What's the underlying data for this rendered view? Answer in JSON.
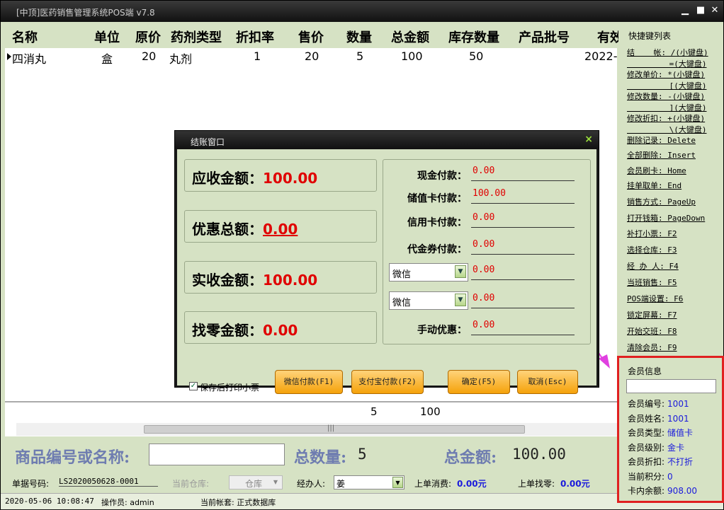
{
  "app": {
    "title": "[中顶]医药销售管理系统POS端 v7.8",
    "min": "▁",
    "max": "■",
    "close": "✕"
  },
  "grid": {
    "headers": [
      "名称",
      "单位",
      "原价",
      "药剂类型",
      "折扣率",
      "售价",
      "数量",
      "总金额",
      "库存数量",
      "产品批号",
      "有效"
    ],
    "row": [
      "四消丸",
      "盒",
      "20",
      "丸剂",
      "1",
      "20",
      "5",
      "100",
      "50",
      "",
      "2022-"
    ],
    "sum_qty": "5",
    "sum_amount": "100",
    "grip": "|||"
  },
  "bottom": {
    "code_label": "商品编号或名称:",
    "code_value": "",
    "total_qty_label": "总数量:",
    "total_qty": "5",
    "total_amount_label": "总金额:",
    "total_amount": "100.00",
    "bill_label": "单据号码:",
    "bill_no": "LS2020050628-0001",
    "warehouse_label": "当前仓库:",
    "warehouse": "仓库",
    "handler_label": "经办人:",
    "handler": "姜",
    "last_spend_label": "上单消费:",
    "last_spend": "0.00元",
    "last_change_label": "上单找零:",
    "last_change": "0.00元"
  },
  "status": {
    "datetime": "2020-05-06 10:08:47",
    "operator": "操作员: admin",
    "account": "当前帐套: 正式数据库"
  },
  "shortcuts": {
    "title": "快捷键列表",
    "items": [
      "结    帐: /(小键盘)",
      "         =(大键盘)",
      "修改单价: *(小键盘)",
      "         [(大键盘)",
      "修改数量: -(小键盘)",
      "         ](大键盘)",
      "修改折扣: +(小键盘)",
      "         \\(大键盘)",
      "删除记录: Delete",
      "全部删除: Insert",
      "会员刷卡: Home",
      "挂单取单: End",
      "销售方式: PageUp",
      "打开钱箱: PageDown",
      "补打小票: F2",
      "选择仓库: F3",
      "经 办 人: F4",
      "当班销售: F5",
      "POS端设置: F6",
      "锁定屏幕: F7",
      "开始交班: F8",
      "清除会员: F9"
    ]
  },
  "member": {
    "title": "会员信息",
    "rows": [
      {
        "label": "会员编号:",
        "value": "1001"
      },
      {
        "label": "会员姓名:",
        "value": "1001"
      },
      {
        "label": "会员类型:",
        "value": "储值卡"
      },
      {
        "label": "会员级别:",
        "value": "金卡"
      },
      {
        "label": "会员折扣:",
        "value": "不打折"
      },
      {
        "label": "当前积分:",
        "value": "0"
      },
      {
        "label": "卡内余额:",
        "value": "908.00"
      }
    ]
  },
  "dialog": {
    "title": "结账窗口",
    "close": "×",
    "receivable_label": "应收金额：",
    "receivable": "100.00",
    "discount_label": "优惠总额：",
    "discount": "0.00",
    "actual_label": "实收金额：",
    "actual": "100.00",
    "change_label": "找零金额：",
    "change": "0.00",
    "cash_label": "现金付款：",
    "cash": "0.00",
    "stored_label": "储值卡付款：",
    "stored": "100.00",
    "credit_label": "信用卡付款：",
    "credit": "0.00",
    "voucher_label": "代金券付款：",
    "voucher": "0.00",
    "select1": "微信",
    "select1_val": "0.00",
    "select2": "微信",
    "select2_val": "0.00",
    "manual_label": "手动优惠：",
    "manual": "0.00",
    "print_label": "保存后打印小票",
    "check_mark": "✓",
    "select_arrow": "▼",
    "btn_wechat": "微信付款(F1)",
    "btn_alipay": "支付宝付款(F2)",
    "btn_ok": "确定(F5)",
    "btn_cancel": "取消(Esc)"
  },
  "colors": {
    "panel": "#d6e2c4",
    "accent_red": "#e00000",
    "member_border": "#e02020",
    "arrow": "#e040e0",
    "button": "#f5a20a"
  }
}
